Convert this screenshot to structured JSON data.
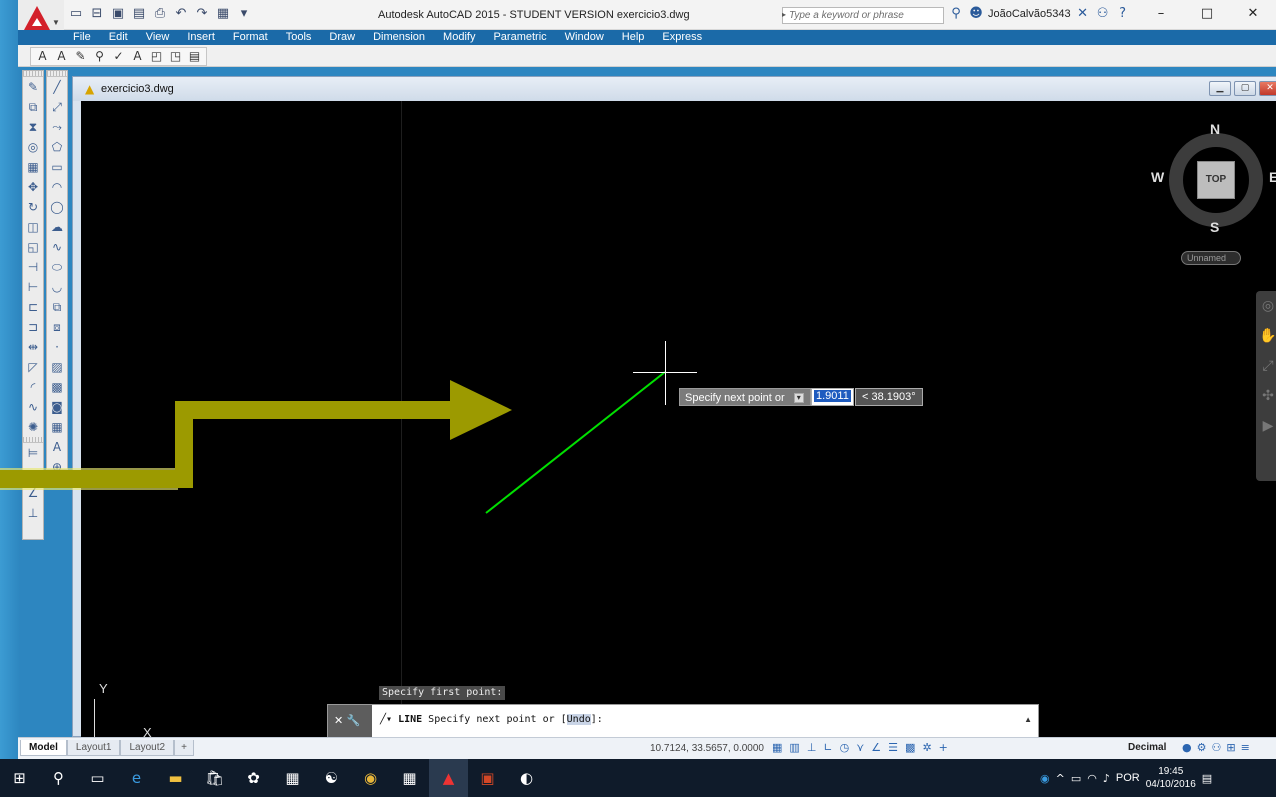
{
  "window": {
    "title": "Autodesk AutoCAD 2015 - STUDENT VERSION    exercicio3.dwg",
    "search_placeholder": "Type a keyword or phrase",
    "user": "JoãoCalvão5343",
    "min": "–",
    "max": "□",
    "close": "✕"
  },
  "menu": [
    "File",
    "Edit",
    "View",
    "Insert",
    "Format",
    "Tools",
    "Draw",
    "Dimension",
    "Modify",
    "Parametric",
    "Window",
    "Help",
    "Express"
  ],
  "drawing": {
    "tab_name": "exercicio3.dwg",
    "viewcube": {
      "north": "N",
      "south": "S",
      "west": "W",
      "east": "E",
      "face": "TOP"
    },
    "ucs_name": "Unnamed",
    "dynamic_input": {
      "prompt": "Specify next point or",
      "distance": "1.9011",
      "angle": "< 38.1903°"
    },
    "ucs": {
      "y": "Y",
      "x": "X"
    },
    "line_color": "#00e000"
  },
  "command": {
    "history": "Specify first point:",
    "keyword": "LINE",
    "prompt_before": " Specify next point or [",
    "option": "Undo",
    "prompt_after": "]:"
  },
  "status": {
    "tabs": [
      "Model",
      "Layout1",
      "Layout2",
      "+"
    ],
    "coords": "10.7124, 33.5657, 0.0000",
    "units": "Decimal"
  },
  "taskbar": {
    "language": "POR",
    "time": "19:45",
    "date": "04/10/2016"
  },
  "colors": {
    "accent_overlay_arrow": "#9c9a00",
    "overlay_band": "#e8e870",
    "menubar": "#1b6aa8"
  }
}
